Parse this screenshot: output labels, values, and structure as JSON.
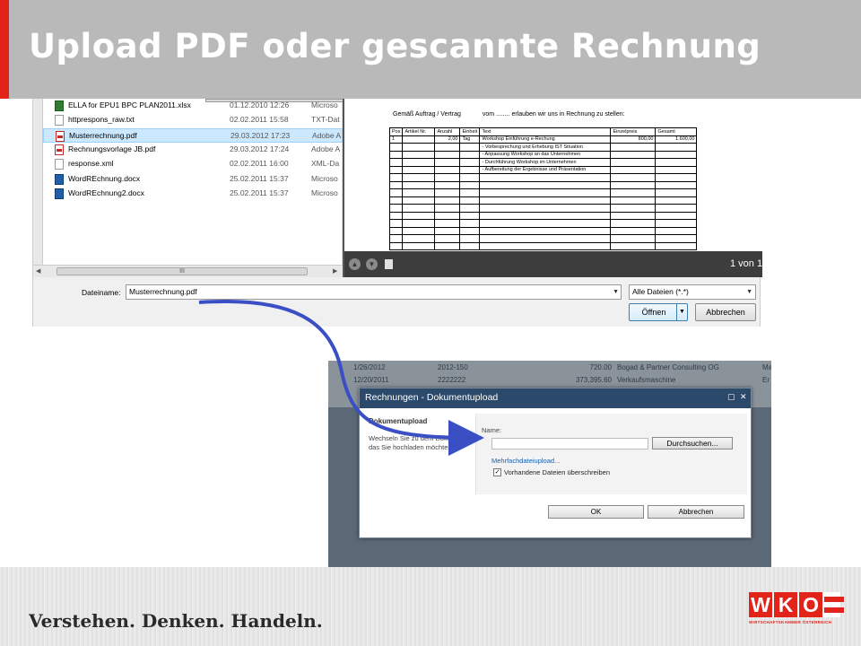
{
  "slide": {
    "title": "Upload PDF oder gescannte Rechnung",
    "slogan": "Verstehen. Denken. Handeln.",
    "logo_letters": [
      "W",
      "K",
      "O"
    ],
    "logo_subtitle": "WIRTSCHAFTSKAMMER ÖSTERREICH",
    "colors": {
      "header": "#b9b9b9",
      "accent_red": "#e2231a",
      "arrow": "#3a4fc4"
    }
  },
  "file_dialog": {
    "files": [
      {
        "name": "ELLA for EPU1 BPC PLAN2011.xlsx",
        "date": "01.12.2010 12:26",
        "type": "Microso",
        "icon": "excel-file-icon",
        "selected": false
      },
      {
        "name": "httprespons_raw.txt",
        "date": "02.02.2011 15:58",
        "type": "TXT-Dat",
        "icon": "text-file-icon",
        "selected": false
      },
      {
        "name": "Musterrechnung.pdf",
        "date": "29.03.2012 17:23",
        "type": "Adobe A",
        "icon": "pdf-file-icon",
        "selected": true
      },
      {
        "name": "Rechnungsvorlage JB.pdf",
        "date": "29.03.2012 17:24",
        "type": "Adobe A",
        "icon": "pdf-file-icon",
        "selected": false
      },
      {
        "name": "response.xml",
        "date": "02.02.2011 16:00",
        "type": "XML-Da",
        "icon": "xml-file-icon",
        "selected": false
      },
      {
        "name": "WordREchnung.docx",
        "date": "25.02.2011 15:37",
        "type": "Microso",
        "icon": "word-file-icon",
        "selected": false
      },
      {
        "name": "WordREchnung2.docx",
        "date": "25.02.2011 15:37",
        "type": "Microso",
        "icon": "word-file-icon",
        "selected": false
      }
    ],
    "scroll_thumb_label": "III",
    "filename_label": "Dateiname:",
    "filename_value": "Musterrechnung.pdf",
    "filter_value": "Alle Dateien (*.*)",
    "open_button": "Öffnen",
    "cancel_button": "Abbrechen"
  },
  "preview": {
    "header_text": "Gemäß Auftrag / Vertrag",
    "header_text_2": "vom ........ erlauben wir uns in Rechnung zu stellen:",
    "table_headers": [
      "Pos",
      "Artikel Nr.",
      "Anzahl",
      "Einheit",
      "Text",
      "Einzelpreis",
      "Gesamt"
    ],
    "table_rows": [
      [
        "1",
        "",
        "2,00",
        "Tag",
        "Workshop Einführung e-Rechung",
        "800,00",
        "1.600,00"
      ],
      [
        "",
        "",
        "",
        "",
        "- Vorbesprechung und Erhebung IST Situation",
        "",
        ""
      ],
      [
        "",
        "",
        "",
        "",
        "- Anpassung Workshop an das Unternehmen",
        "",
        ""
      ],
      [
        "",
        "",
        "",
        "",
        "- Durchführung Workshop im Unternehmen",
        "",
        ""
      ],
      [
        "",
        "",
        "",
        "",
        "- Aufbereitung der Ergebnisse und Präsentation",
        "",
        ""
      ]
    ],
    "empty_rows": 10,
    "page_indicator": "1 von 1"
  },
  "sharepoint": {
    "rows": [
      {
        "date": "1/26/2012",
        "number": "2012-150",
        "amount": "720.00",
        "company": "Bogad & Partner Consulting OG",
        "extra": "Ma"
      },
      {
        "date": "12/20/2011",
        "number": "2222222",
        "amount": "373,395.60",
        "company": "Verkaufsmaschine",
        "extra": "Er"
      }
    ],
    "modal_title": "Rechnungen - Dokumentupload",
    "section_heading": "Dokumentupload",
    "section_description": "Wechseln Sie zu dem Dokument, das Sie hochladen möchten.",
    "name_label": "Name:",
    "browse_button": "Durchsuchen...",
    "multi_upload_link": "Mehrfachdateiupload...",
    "overwrite_label": "Vorhandene Dateien überschreiben",
    "overwrite_checked": true,
    "ok_button": "OK",
    "cancel_button": "Abbrechen"
  }
}
